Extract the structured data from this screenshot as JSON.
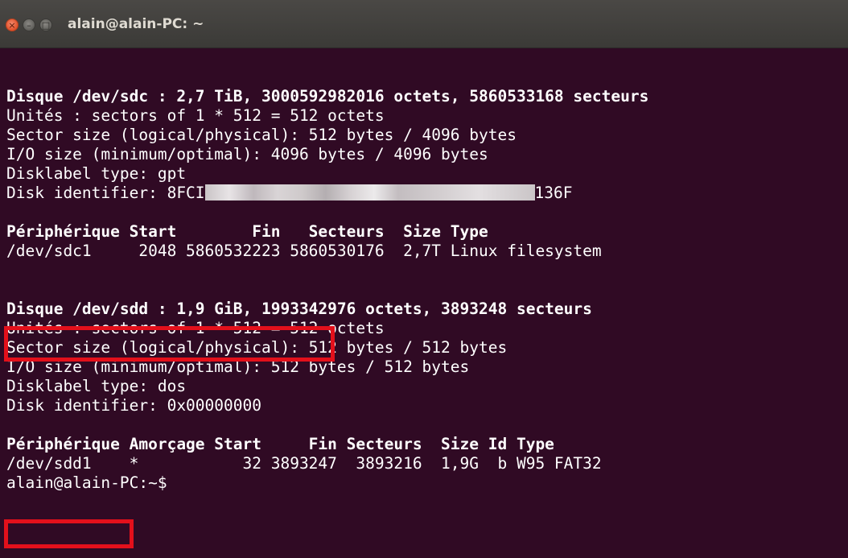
{
  "window": {
    "title": "alain@alain-PC: ~"
  },
  "terminal": {
    "lines": [
      "",
      "",
      "Disque /dev/sdc : 2,7 TiB, 3000592982016 octets, 5860533168 secteurs",
      "Unités : sectors of 1 * 512 = 512 octets",
      "Sector size (logical/physical): 512 bytes / 4096 bytes",
      "I/O size (minimum/optimal): 4096 bytes / 4096 bytes",
      "Disklabel type: gpt",
      "",
      "",
      "Périphérique Start        Fin   Secteurs  Size Type",
      "/dev/sdc1     2048 5860532223 5860530176  2,7T Linux filesystem",
      "",
      "",
      "Disque /dev/sdd : 1,9 GiB, 1993342976 octets, 3893248 secteurs",
      "Unités : sectors of 1 * 512 = 512 octets",
      "Sector size (logical/physical): 512 bytes / 512 bytes",
      "I/O size (minimum/optimal): 512 bytes / 512 bytes",
      "Disklabel type: dos",
      "Disk identifier: 0x00000000",
      "",
      "Périphérique Amorçage Start     Fin Secteurs  Size Id Type",
      "/dev/sdd1    *           32 3893247  3893216  1,9G  b W95 FAT32",
      "alain@alain-PC:~$"
    ],
    "disk_identifier_prefix": "Disk identifier: 8FCI",
    "disk_identifier_suffix": "136F"
  }
}
